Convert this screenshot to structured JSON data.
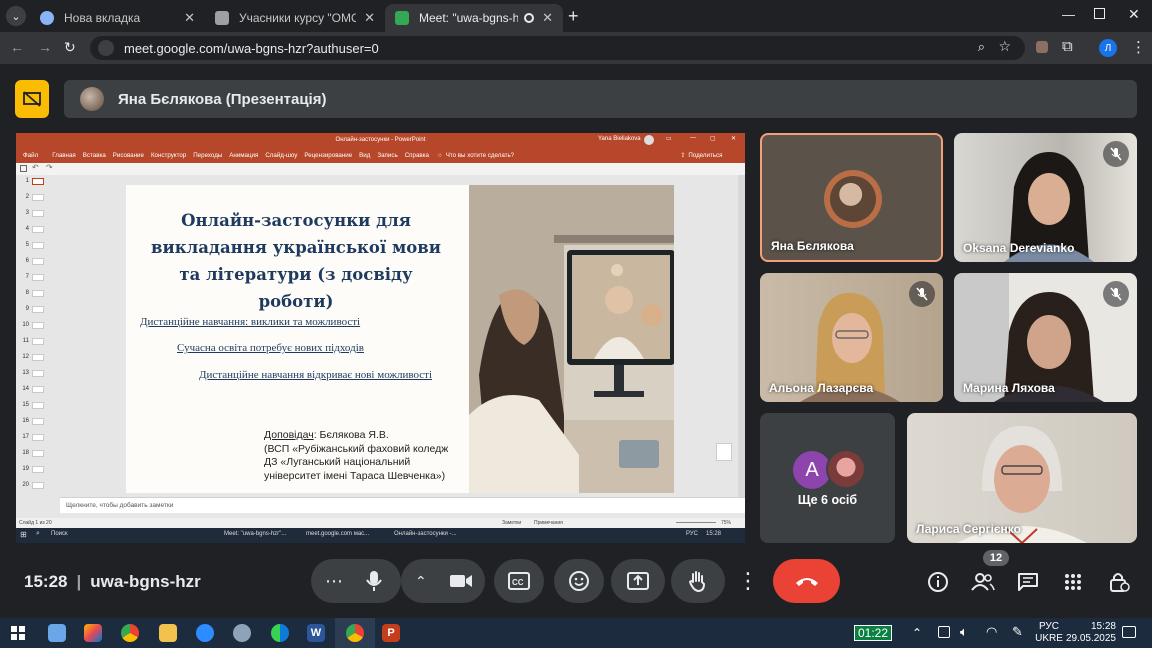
{
  "browser": {
    "tabs": [
      {
        "title": "Нова вкладка",
        "favicon_color": "#8ab4f8"
      },
      {
        "title": "Учасники курсу \"ОМО виклад",
        "favicon_color": "#9aa0a6"
      },
      {
        "title": "Meet: \"uwa-bgns-hzr\"",
        "favicon_color": "#34a853"
      }
    ],
    "url": "meet.google.com/uwa-bgns-hzr?authuser=0",
    "profile_initial": "Л"
  },
  "meet": {
    "presenter_label": "Яна Бєлякова (Презентація)",
    "clock": "15:28",
    "meeting_code": "uwa-bgns-hzr",
    "participant_count": "12",
    "participants": [
      {
        "name": "Яна Бєлякова",
        "muted": false
      },
      {
        "name": "Oksana Derevianko",
        "muted": true
      },
      {
        "name": "Альона Лазарєва",
        "muted": true
      },
      {
        "name": "Марина Ляхова",
        "muted": true
      },
      {
        "name": "Лариса Сергієнко",
        "muted": false
      }
    ],
    "others": {
      "label": "Ще 6 осіб",
      "avatar_letter": "A",
      "avatar_color": "#8e44ad"
    },
    "end_call_color": "#ea4335"
  },
  "powerpoint": {
    "window_title": "Онлайн-застосунки - PowerPoint",
    "user": "Yana Bieliakova",
    "ribbon": [
      "Файл",
      "Главная",
      "Вставка",
      "Рисование",
      "Конструктор",
      "Переходы",
      "Анимация",
      "Слайд-шоу",
      "Рецензирование",
      "Вид",
      "Запись",
      "Справка",
      "Что вы хотите сделать?"
    ],
    "share": "Поделиться",
    "slide_numbers": [
      "1",
      "2",
      "3",
      "4",
      "5",
      "6",
      "7",
      "8",
      "9",
      "10",
      "11",
      "12",
      "13",
      "14",
      "15",
      "16",
      "17",
      "18",
      "19",
      "20"
    ],
    "notes_placeholder": "Щелкните, чтобы добавить заметки",
    "status_left": "Слайд 1 из 20",
    "status_notes": "Заметки",
    "status_comments": "Примечания",
    "zoom": "75%",
    "taskbar_search": "Поиск",
    "taskbar_items": [
      "Meet: \"uwa-bgns-hzr\"...",
      "meet.google.com мас...",
      "Онлайн-застосунки -..."
    ],
    "taskbar_lang": "РУС",
    "taskbar_time": "15:28"
  },
  "slide": {
    "title": "Онлайн-застосунки для викладання української мови та літератури (з досвіду роботи)",
    "lines": [
      "Дистанційне навчання: виклики та можливості",
      "Сучасна освіта потребує нових підходів",
      "Дистанційне навчання відкриває нові можливості"
    ],
    "author_label": "Доповідач",
    "author_name": ": Бєлякова Я.В.",
    "affiliation": [
      "(ВСП «Рубіжанський фаховий коледж",
      "ДЗ «Луганський  національний",
      "університет  імені Тараса Шевченка»)"
    ]
  },
  "os_taskbar": {
    "timer": "01:22",
    "lang_top": "РУС",
    "lang_bottom": "UKRE",
    "time": "15:28",
    "date": "29.05.2025"
  }
}
